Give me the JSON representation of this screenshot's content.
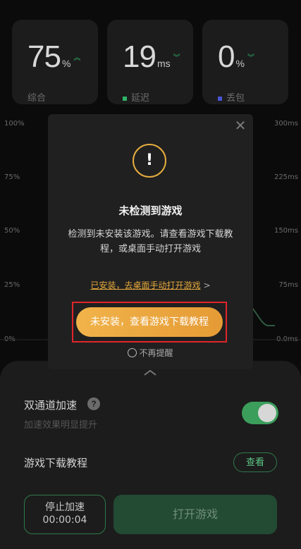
{
  "stats": [
    {
      "value": "75",
      "unit": "%",
      "label": "综合",
      "dot_color": ""
    },
    {
      "value": "19",
      "unit": "ms",
      "label": "延迟",
      "dot_color": "#2fb36a"
    },
    {
      "value": "0",
      "unit": "%",
      "label": "丢包",
      "dot_color": "#4a54d8"
    }
  ],
  "graph": {
    "left_axis": [
      "100%",
      "75%",
      "50%",
      "25%",
      "0%"
    ],
    "right_axis": [
      "300ms",
      "225ms",
      "150ms",
      "75ms",
      "0.0ms"
    ]
  },
  "dialog": {
    "title": "未检测到游戏",
    "message": "检测到未安装该游戏。请查看游戏下载教程，或桌面手动打开游戏",
    "link_text": "已安装，去桌面手动打开游戏",
    "link_arrow": ">",
    "primary_button": "未安装，查看游戏下载教程",
    "no_remind": "不再提醒",
    "warning_glyph": "!",
    "close_glyph": "✕",
    "accent_color": "#e6a93b"
  },
  "sheet": {
    "dual_channel_title": "双通道加速",
    "dual_channel_sub": "加速效果明显提升",
    "dual_channel_enabled": true,
    "tutorial_title": "游戏下载教程",
    "view_button": "查看",
    "stop_button_line1": "停止加速",
    "stop_button_timer": "00:00:04",
    "open_game_button": "打开游戏",
    "help_glyph": "?"
  }
}
